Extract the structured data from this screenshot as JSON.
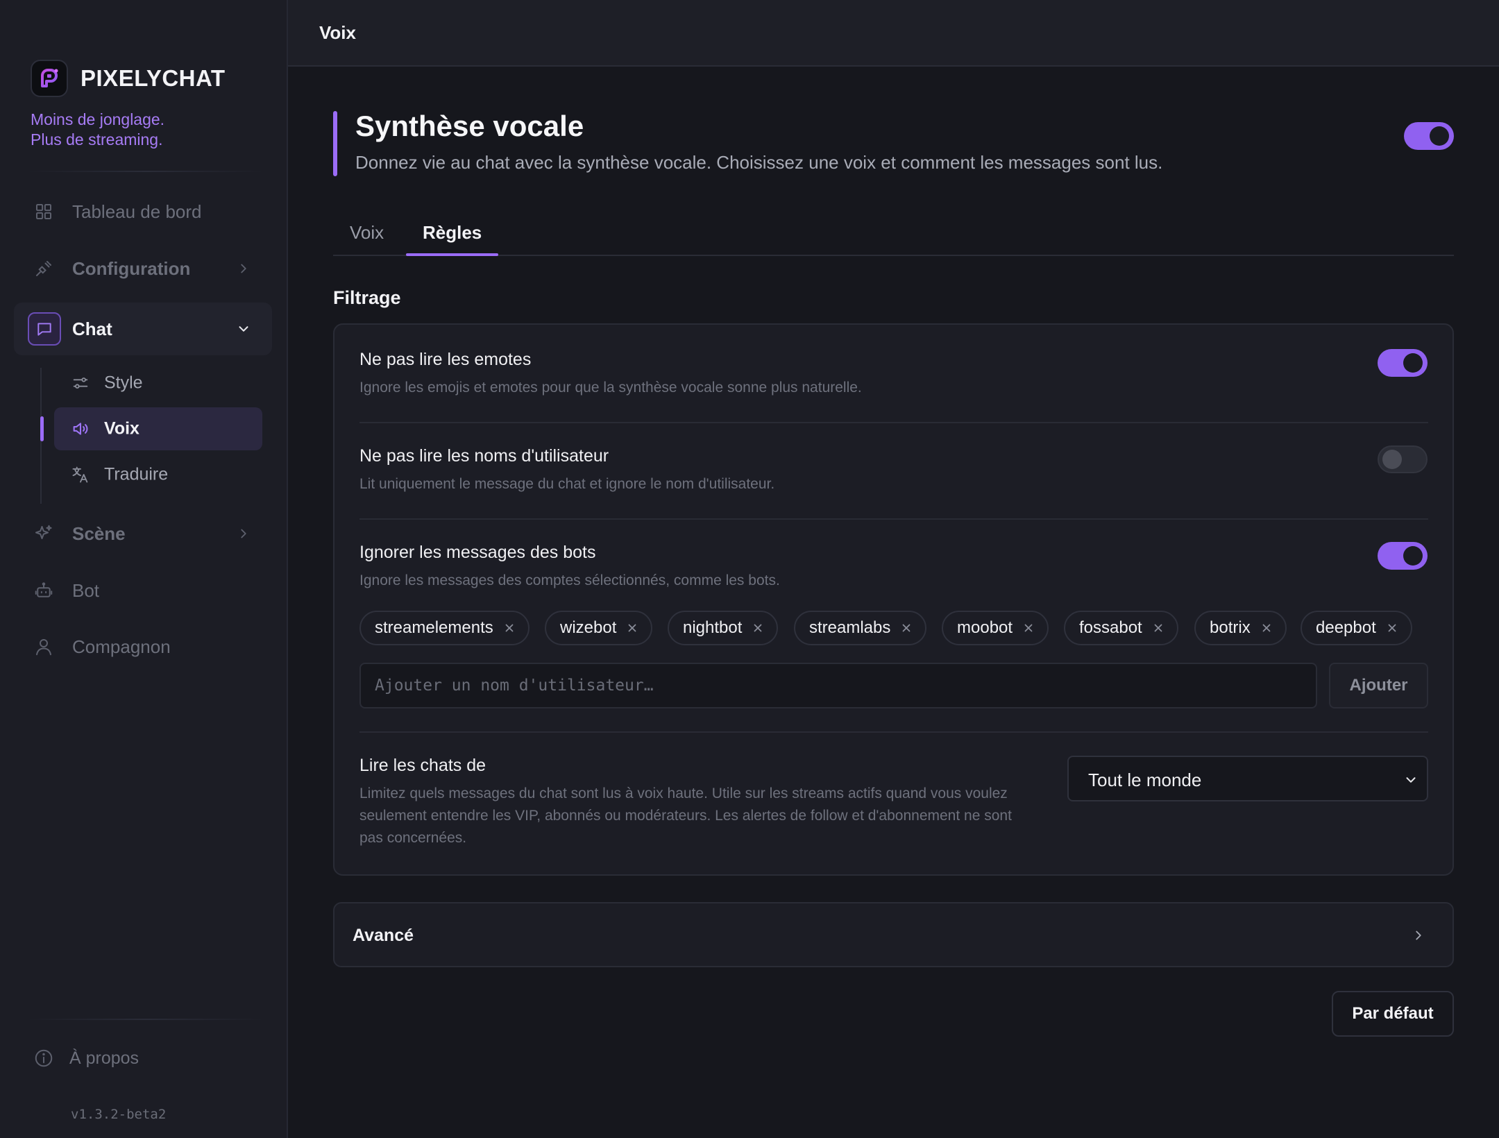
{
  "brand": {
    "name": "PIXELYCHAT",
    "tagline_line1": "Moins de jonglage.",
    "tagline_line2": "Plus de streaming."
  },
  "sidebar": {
    "items": [
      {
        "label": "Tableau de bord",
        "icon": "dashboard-grid-icon"
      },
      {
        "label": "Configuration",
        "icon": "plug-icon"
      },
      {
        "label": "Chat",
        "icon": "chat-bubble-icon",
        "active": true
      },
      {
        "label": "Scène",
        "icon": "sparkles-icon"
      },
      {
        "label": "Bot",
        "icon": "robot-icon"
      },
      {
        "label": "Compagnon",
        "icon": "user-icon"
      }
    ],
    "chat_subitems": [
      {
        "label": "Style",
        "icon": "sliders-icon"
      },
      {
        "label": "Voix",
        "icon": "speaker-icon",
        "active": true
      },
      {
        "label": "Traduire",
        "icon": "translate-icon"
      }
    ],
    "about": "À propos",
    "version": "v1.3.2-beta2"
  },
  "topbar": {
    "title": "Voix"
  },
  "header": {
    "title": "Synthèse vocale",
    "subtitle": "Donnez vie au chat avec la synthèse vocale. Choisissez une voix et comment les messages sont lus.",
    "enabled": true
  },
  "tabs": [
    {
      "label": "Voix"
    },
    {
      "label": "Règles",
      "active": true
    }
  ],
  "filtering": {
    "section_title": "Filtrage",
    "rows": [
      {
        "title": "Ne pas lire les emotes",
        "desc": "Ignore les emojis et emotes pour que la synthèse vocale sonne plus naturelle.",
        "enabled": true
      },
      {
        "title": "Ne pas lire les noms d'utilisateur",
        "desc": "Lit uniquement le message du chat et ignore le nom d'utilisateur.",
        "enabled": false
      },
      {
        "title": "Ignorer les messages des bots",
        "desc": "Ignore les messages des comptes sélectionnés, comme les bots.",
        "enabled": true
      }
    ],
    "bots": [
      "streamelements",
      "wizebot",
      "nightbot",
      "streamlabs",
      "moobot",
      "fossabot",
      "botrix",
      "deepbot"
    ],
    "add_placeholder": "Ajouter un nom d'utilisateur…",
    "add_button": "Ajouter",
    "read_from": {
      "title": "Lire les chats de",
      "desc_line1": "Limitez quels messages du chat sont lus à voix haute. Utile sur les streams actifs quand vous voulez",
      "desc_line2": "seulement entendre les VIP, abonnés ou modérateurs. Les alertes de follow et d'abonnement ne sont",
      "desc_line3": "pas concernées.",
      "selected": "Tout le monde"
    }
  },
  "advanced": {
    "label": "Avancé"
  },
  "default_button": "Par défaut",
  "colors": {
    "accent": "#9b6cf7",
    "background": "#16171d",
    "sidebar": "#1c1d25"
  }
}
